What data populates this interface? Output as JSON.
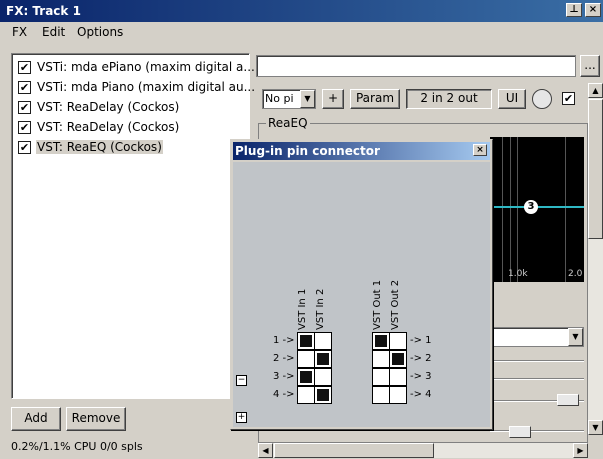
{
  "window": {
    "title": "FX: Track 1",
    "pin_glyph": "⊥",
    "close_glyph": "×"
  },
  "menu": [
    "FX",
    "Edit",
    "Options"
  ],
  "fx_list": [
    {
      "label": "VSTi: mda ePiano (maxim digital a...",
      "checked": true,
      "selected": false
    },
    {
      "label": "VSTi: mda Piano (maxim digital au...",
      "checked": true,
      "selected": false
    },
    {
      "label": "VST: ReaDelay (Cockos)",
      "checked": true,
      "selected": false
    },
    {
      "label": "VST: ReaDelay (Cockos)",
      "checked": true,
      "selected": false
    },
    {
      "label": "VST: ReaEQ (Cockos)",
      "checked": true,
      "selected": true
    }
  ],
  "checkmark": "✔",
  "buttons": {
    "add": "Add",
    "remove": "Remove",
    "dots": "...",
    "plus": "+",
    "param": "Param",
    "io": "2 in 2 out",
    "ui": "UI"
  },
  "status": {
    "cpu": "0.2%/1.1% CPU 0/0 spls"
  },
  "preset_select": {
    "value": "No pi"
  },
  "plugin_group": {
    "label": "ReaEQ"
  },
  "eq": {
    "node_label": "3",
    "freq_labels": [
      "1.0k",
      "2.0"
    ],
    "curve_color": "#2fb8c4"
  },
  "pin_connector": {
    "title": "Plug-in pin connector",
    "close": "×",
    "input_labels": [
      "VST In 1",
      "VST In 2"
    ],
    "output_labels": [
      "VST Out 1",
      "VST Out 2"
    ],
    "input_rows": [
      "1 ->",
      "2 ->",
      "3 ->",
      "4 ->"
    ],
    "output_rows": [
      "-> 1",
      "-> 2",
      "-> 3",
      "-> 4"
    ],
    "input_matrix": [
      [
        1,
        0
      ],
      [
        0,
        1
      ],
      [
        1,
        0
      ],
      [
        0,
        1
      ]
    ],
    "output_matrix": [
      [
        1,
        0
      ],
      [
        0,
        1
      ],
      [
        0,
        0
      ],
      [
        0,
        0
      ]
    ],
    "minus": "−",
    "plus": "+"
  },
  "colors": {
    "titlebar": "#0a246a",
    "selection": "#d4d0c8",
    "eq_background": "#000000"
  }
}
